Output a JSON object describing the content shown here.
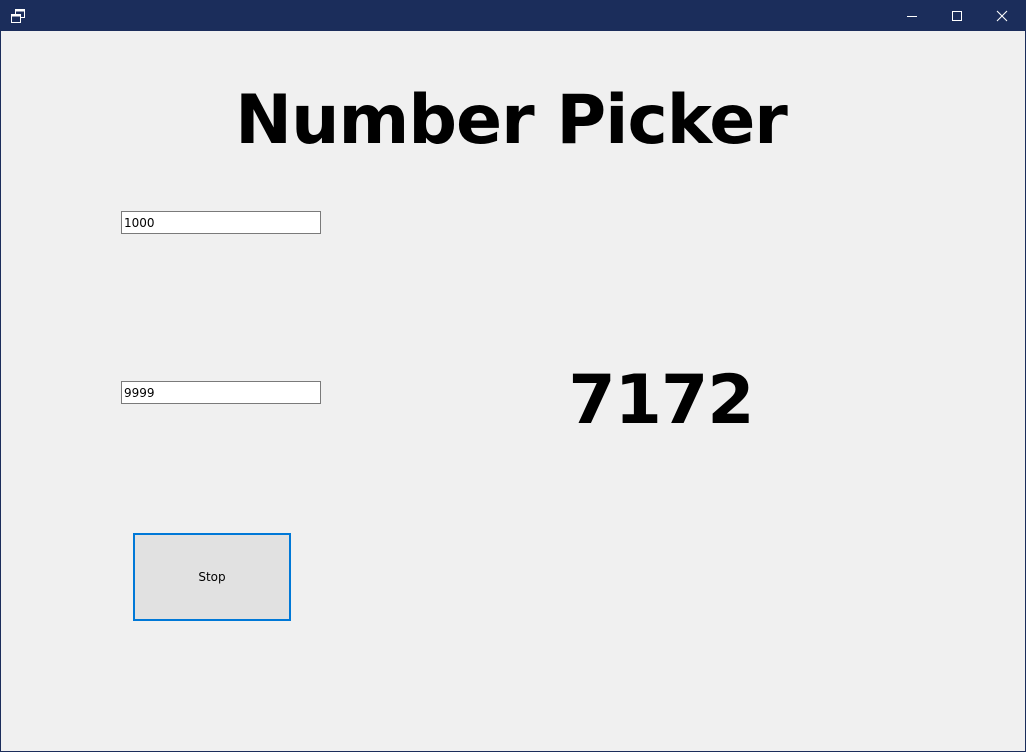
{
  "window": {
    "titlebar_color": "#1b2d5b",
    "controls": {
      "minimize_icon": "minimize-icon",
      "maximize_icon": "maximize-icon",
      "close_icon": "close-icon"
    }
  },
  "main": {
    "heading": "Number Picker",
    "min_value": "1000",
    "max_value": "9999",
    "result": "7172",
    "stop_label": "Stop"
  },
  "colors": {
    "background": "#f0f0f0",
    "button_face": "#e1e1e1",
    "focus_border": "#0078d7"
  }
}
